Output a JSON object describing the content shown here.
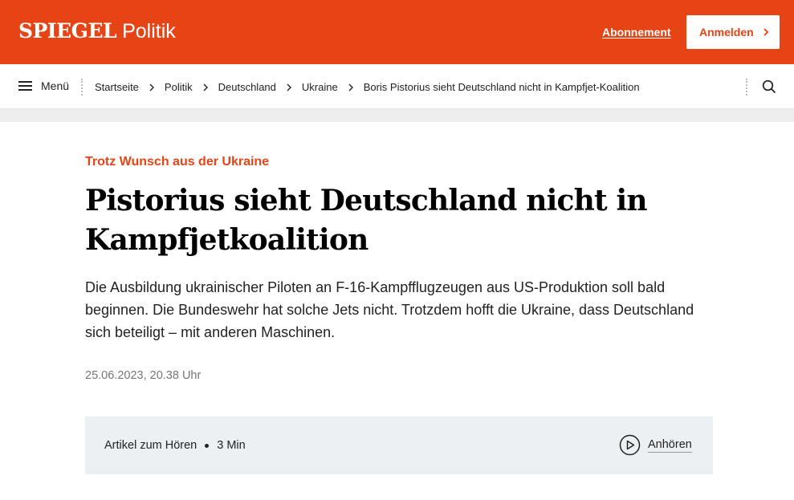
{
  "header": {
    "logo": "SPIEGEL",
    "section": "Politik",
    "subscribe_label": "Abonnement",
    "login_label": "Anmelden",
    "brand_color": "#e64415"
  },
  "nav": {
    "menu_label": "Menü",
    "breadcrumbs": [
      "Startseite",
      "Politik",
      "Deutschland",
      "Ukraine",
      "Boris Pistorius sieht Deutschland nicht in Kampfjet-Koalition"
    ],
    "search_icon": "search-icon"
  },
  "article": {
    "kicker": "Trotz Wunsch aus der Ukraine",
    "headline": "Pistorius sieht Deutschland nicht in Kampfjetkoalition",
    "lead": "Die Ausbildung ukrainischer Piloten an F-16-Kampfflugzeugen aus US-Produktion soll bald beginnen. Die Bundeswehr hat solche Jets nicht. Trotzdem hofft die Ukraine, dass Deutschland sich beteiligt – mit anderen Maschinen.",
    "date": "25.06.2023, 20.38 Uhr"
  },
  "audio": {
    "label": "Artikel zum Hören",
    "duration": "3 Min",
    "listen_label": "Anhören",
    "play_icon": "play-icon"
  }
}
